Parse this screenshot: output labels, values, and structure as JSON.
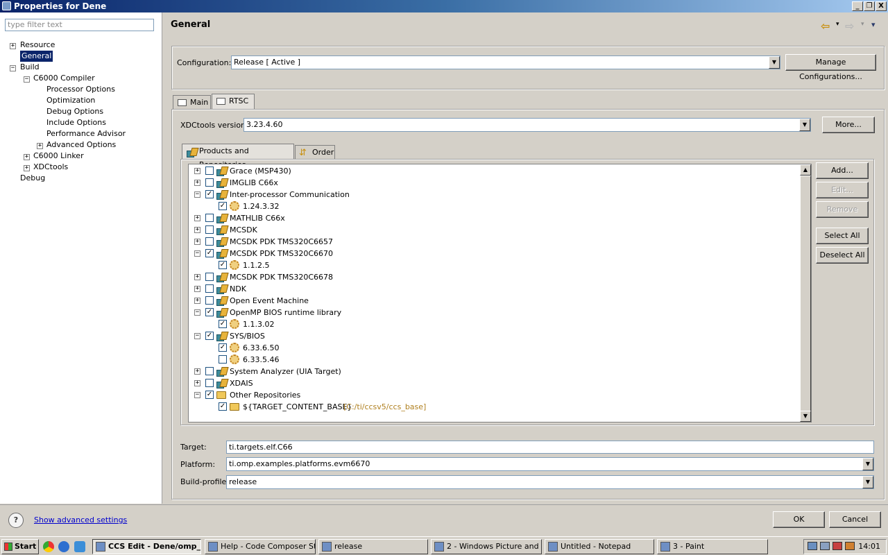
{
  "window": {
    "title": "Properties for Dene",
    "min": "_",
    "max": "❐",
    "close": "X"
  },
  "left": {
    "filter_placeholder": "type filter text",
    "tree": [
      {
        "label": "Resource",
        "expander": "+"
      },
      {
        "label": "General",
        "selected": true
      },
      {
        "label": "Build",
        "expander": "−"
      },
      {
        "label": "C6000 Compiler",
        "expander": "−"
      },
      {
        "label": "Processor Options"
      },
      {
        "label": "Optimization"
      },
      {
        "label": "Debug Options"
      },
      {
        "label": "Include Options"
      },
      {
        "label": "Performance Advisor"
      },
      {
        "label": "Advanced Options",
        "expander": "+"
      },
      {
        "label": "C6000 Linker",
        "expander": "+"
      },
      {
        "label": "XDCtools",
        "expander": "+"
      },
      {
        "label": "Debug"
      }
    ]
  },
  "header": {
    "title": "General",
    "back_icon": "⇦",
    "forward_icon": "⇨",
    "menu_icon": "▾"
  },
  "configuration": {
    "label": "Configuration:",
    "value": "Release  [ Active ]",
    "manage_button": "Manage Configurations..."
  },
  "tabs": [
    {
      "label": "Main"
    },
    {
      "label": "RTSC"
    }
  ],
  "rtsc": {
    "xdc_label": "XDCtools version:",
    "xdc_value": "3.23.4.60",
    "more_button": "More...",
    "subtabs": [
      {
        "label": "Products and Repositories"
      },
      {
        "label": "Order"
      }
    ],
    "buttons": {
      "add": "Add...",
      "edit": "Edit...",
      "remove": "Remove",
      "select_all": "Select All",
      "deselect_all": "Deselect All"
    },
    "items": [
      {
        "label": "Grace (MSP430)",
        "checked": false,
        "level": 0,
        "expander": "+"
      },
      {
        "label": "IMGLIB C66x",
        "checked": false,
        "level": 0,
        "expander": "+"
      },
      {
        "label": "Inter-processor Communication",
        "checked": true,
        "level": 0,
        "expander": "−"
      },
      {
        "label": "1.24.3.32",
        "checked": true,
        "level": 1
      },
      {
        "label": "MATHLIB C66x",
        "checked": false,
        "level": 0,
        "expander": "+"
      },
      {
        "label": "MCSDK",
        "checked": false,
        "level": 0,
        "expander": "+"
      },
      {
        "label": "MCSDK PDK TMS320C6657",
        "checked": false,
        "level": 0,
        "expander": "+"
      },
      {
        "label": "MCSDK PDK TMS320C6670",
        "checked": true,
        "level": 0,
        "expander": "−"
      },
      {
        "label": "1.1.2.5",
        "checked": true,
        "level": 1
      },
      {
        "label": "MCSDK PDK TMS320C6678",
        "checked": false,
        "level": 0,
        "expander": "+"
      },
      {
        "label": "NDK",
        "checked": false,
        "level": 0,
        "expander": "+"
      },
      {
        "label": "Open Event Machine",
        "checked": false,
        "level": 0,
        "expander": "+"
      },
      {
        "label": "OpenMP BIOS runtime library",
        "checked": true,
        "level": 0,
        "expander": "−"
      },
      {
        "label": "1.1.3.02",
        "checked": true,
        "level": 1
      },
      {
        "label": "SYS/BIOS",
        "checked": true,
        "level": 0,
        "expander": "−"
      },
      {
        "label": "6.33.6.50",
        "checked": true,
        "level": 1
      },
      {
        "label": "6.33.5.46",
        "checked": false,
        "level": 1
      },
      {
        "label": "System Analyzer (UIA Target)",
        "checked": false,
        "level": 0,
        "expander": "+"
      },
      {
        "label": "XDAIS",
        "checked": false,
        "level": 0,
        "expander": "+"
      },
      {
        "label": "Other Repositories",
        "checked": true,
        "level": 0,
        "expander": "−",
        "folder": true
      },
      {
        "label": "${TARGET_CONTENT_BASE}",
        "checked": true,
        "level": 1,
        "folder": true,
        "path": "[C:/ti/ccsv5/ccs_base]"
      }
    ],
    "target_label": "Target:",
    "target_value": "ti.targets.elf.C66",
    "platform_label": "Platform:",
    "platform_value": "ti.omp.examples.platforms.evm6670",
    "profile_label": "Build-profile:",
    "profile_value": "release"
  },
  "bottom": {
    "help_icon": "?",
    "advanced_link": "Show advanced settings",
    "ok": "OK",
    "cancel": "Cancel"
  },
  "taskbar": {
    "start": "Start",
    "tasks": [
      {
        "label": "CCS Edit - Dene/omp_..."
      },
      {
        "label": "Help - Code Composer St..."
      },
      {
        "label": "release"
      },
      {
        "label": "2 - Windows Picture and ..."
      },
      {
        "label": "Untitled - Notepad"
      },
      {
        "label": "3 - Paint"
      }
    ],
    "clock": "14:01"
  }
}
